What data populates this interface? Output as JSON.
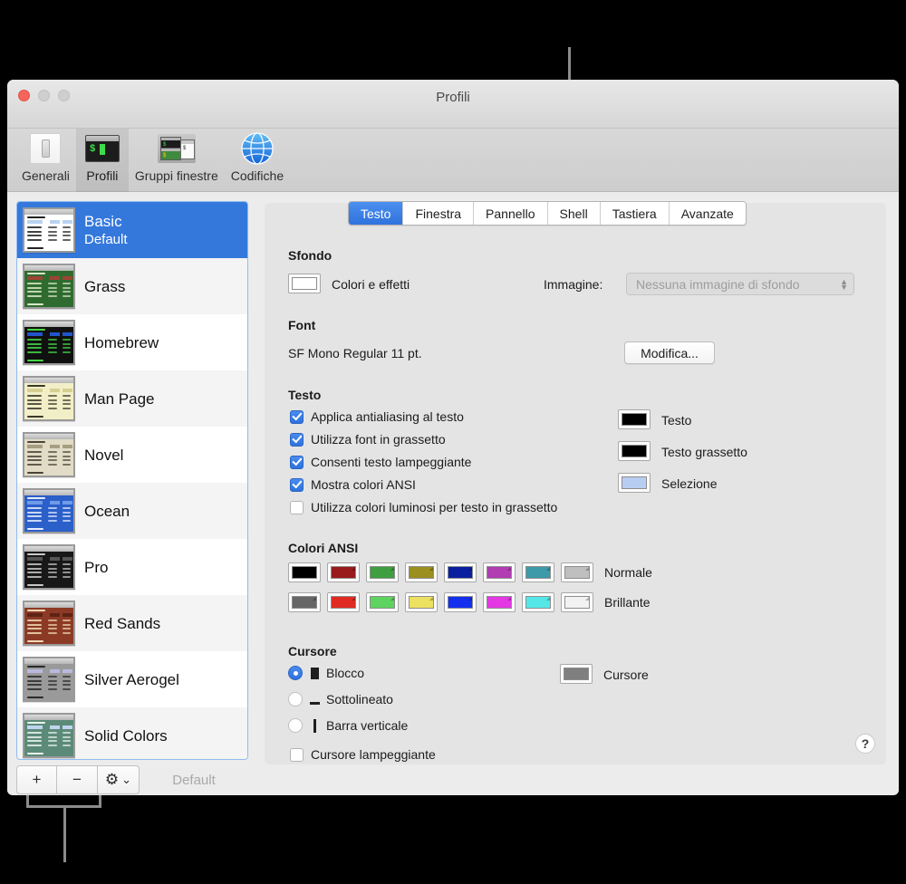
{
  "window": {
    "title": "Profili",
    "traffic_lights": [
      "close",
      "minimize",
      "zoom"
    ]
  },
  "toolbar": {
    "items": [
      {
        "label": "Generali",
        "icon": "general-switch-icon",
        "selected": false
      },
      {
        "label": "Profili",
        "icon": "terminal-window-icon",
        "selected": true
      },
      {
        "label": "Gruppi finestre",
        "icon": "window-groups-icon",
        "selected": false
      },
      {
        "label": "Codifiche",
        "icon": "globe-icon",
        "selected": false
      }
    ]
  },
  "sidebar": {
    "profiles": [
      {
        "name": "Basic",
        "sub": "Default",
        "selected": true,
        "bg": "#ffffff",
        "fg": "#222222",
        "accent": "#b9d3f2"
      },
      {
        "name": "Grass",
        "sub": "",
        "selected": false,
        "bg": "#2f6b2f",
        "fg": "#d7e7c8",
        "accent": "#9e4434"
      },
      {
        "name": "Homebrew",
        "sub": "",
        "selected": false,
        "bg": "#101010",
        "fg": "#44d544",
        "accent": "#2255cc"
      },
      {
        "name": "Man Page",
        "sub": "",
        "selected": false,
        "bg": "#f2efc8",
        "fg": "#3a3a2a",
        "accent": "#d6d092"
      },
      {
        "name": "Novel",
        "sub": "",
        "selected": false,
        "bg": "#e2dcc6",
        "fg": "#4a4438",
        "accent": "#a79e82"
      },
      {
        "name": "Ocean",
        "sub": "",
        "selected": false,
        "bg": "#2b5fc9",
        "fg": "#e6ecff",
        "accent": "#6f9be8"
      },
      {
        "name": "Pro",
        "sub": "",
        "selected": false,
        "bg": "#181818",
        "fg": "#c8c8c8",
        "accent": "#555555"
      },
      {
        "name": "Red Sands",
        "sub": "",
        "selected": false,
        "bg": "#8c3a26",
        "fg": "#f0d9b5",
        "accent": "#5d2315"
      },
      {
        "name": "Silver Aerogel",
        "sub": "",
        "selected": false,
        "bg": "#9a9a9a",
        "fg": "#2a2a2a",
        "accent": "#b9b9e0"
      },
      {
        "name": "Solid Colors",
        "sub": "",
        "selected": false,
        "bg": "#5c8a78",
        "fg": "#e9f3ee",
        "accent": "#bfd4ee"
      }
    ],
    "buttons": {
      "add": "+",
      "remove": "−",
      "gear": "⚙",
      "gear_chevron": "⌄",
      "default_label": "Default"
    }
  },
  "tabs": [
    {
      "label": "Testo",
      "active": true
    },
    {
      "label": "Finestra",
      "active": false
    },
    {
      "label": "Pannello",
      "active": false
    },
    {
      "label": "Shell",
      "active": false
    },
    {
      "label": "Tastiera",
      "active": false
    },
    {
      "label": "Avanzate",
      "active": false
    }
  ],
  "panel": {
    "background": {
      "title": "Sfondo",
      "colors_effects_label": "Colori e effetti",
      "color": "#ffffff",
      "image_label": "Immagine:",
      "image_value": "Nessuna immagine di sfondo"
    },
    "font": {
      "title": "Font",
      "value": "SF Mono Regular 11 pt.",
      "change_button": "Modifica..."
    },
    "text": {
      "title": "Testo",
      "checkboxes": [
        {
          "label": "Applica antialiasing al testo",
          "checked": true
        },
        {
          "label": "Utilizza font in grassetto",
          "checked": true
        },
        {
          "label": "Consenti testo lampeggiante",
          "checked": true
        },
        {
          "label": "Mostra colori ANSI",
          "checked": true
        },
        {
          "label": "Utilizza colori luminosi per testo in grassetto",
          "checked": false
        }
      ],
      "color_wells": [
        {
          "label": "Testo",
          "color": "#000000"
        },
        {
          "label": "Testo grassetto",
          "color": "#000000"
        },
        {
          "label": "Selezione",
          "color": "#b7cdf2"
        }
      ]
    },
    "ansi": {
      "title": "Colori ANSI",
      "normal_label": "Normale",
      "bright_label": "Brillante",
      "normal": [
        "#000000",
        "#991b1b",
        "#3f9e3f",
        "#9a8f1f",
        "#0a1fa0",
        "#b23cb2",
        "#3d9aa8",
        "#bfbfbf"
      ],
      "bright": [
        "#666666",
        "#e02b22",
        "#5fd35f",
        "#ece160",
        "#1430ef",
        "#e438e4",
        "#55e7e7",
        "#f2f2f2"
      ]
    },
    "cursor": {
      "title": "Cursore",
      "options": [
        {
          "label": "Blocco",
          "glyph": "block",
          "selected": true
        },
        {
          "label": "Sottolineato",
          "glyph": "underline",
          "selected": false
        },
        {
          "label": "Barra verticale",
          "glyph": "bar",
          "selected": false
        }
      ],
      "blink_label": "Cursore lampeggiante",
      "blink_checked": false,
      "color_well_label": "Cursore",
      "color_well_color": "#7f7f7f"
    },
    "help_button": "?"
  }
}
